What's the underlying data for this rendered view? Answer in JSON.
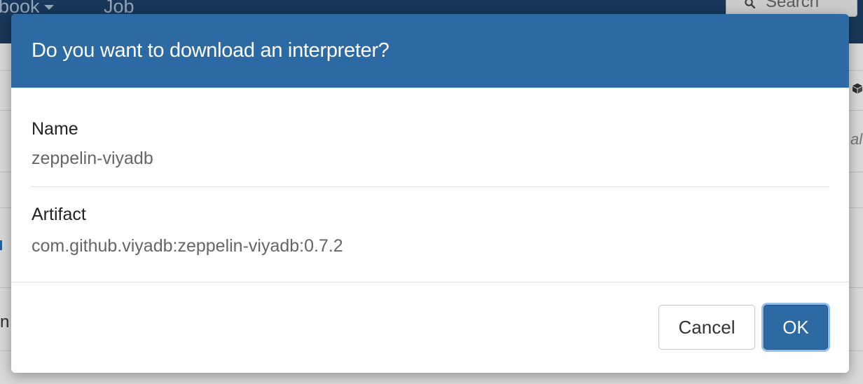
{
  "background": {
    "nav_notebook_label": "book",
    "nav_job_label": "Job",
    "search_label": "Search",
    "side_text_fragment": "al",
    "left_text_fragment": "n"
  },
  "dialog": {
    "title": "Do you want to download an interpreter?",
    "fields": [
      {
        "label": "Name",
        "value": "zeppelin-viyadb"
      },
      {
        "label": "Artifact",
        "value": "com.github.viyadb:zeppelin-viyadb:0.7.2"
      }
    ],
    "buttons": {
      "cancel_label": "Cancel",
      "ok_label": "OK"
    }
  },
  "colors": {
    "header_blue": "#2d6aa3",
    "navbar": "#1d3f66",
    "primary_button": "#2d6aa3",
    "focus_ring": "#8fbfe8"
  }
}
